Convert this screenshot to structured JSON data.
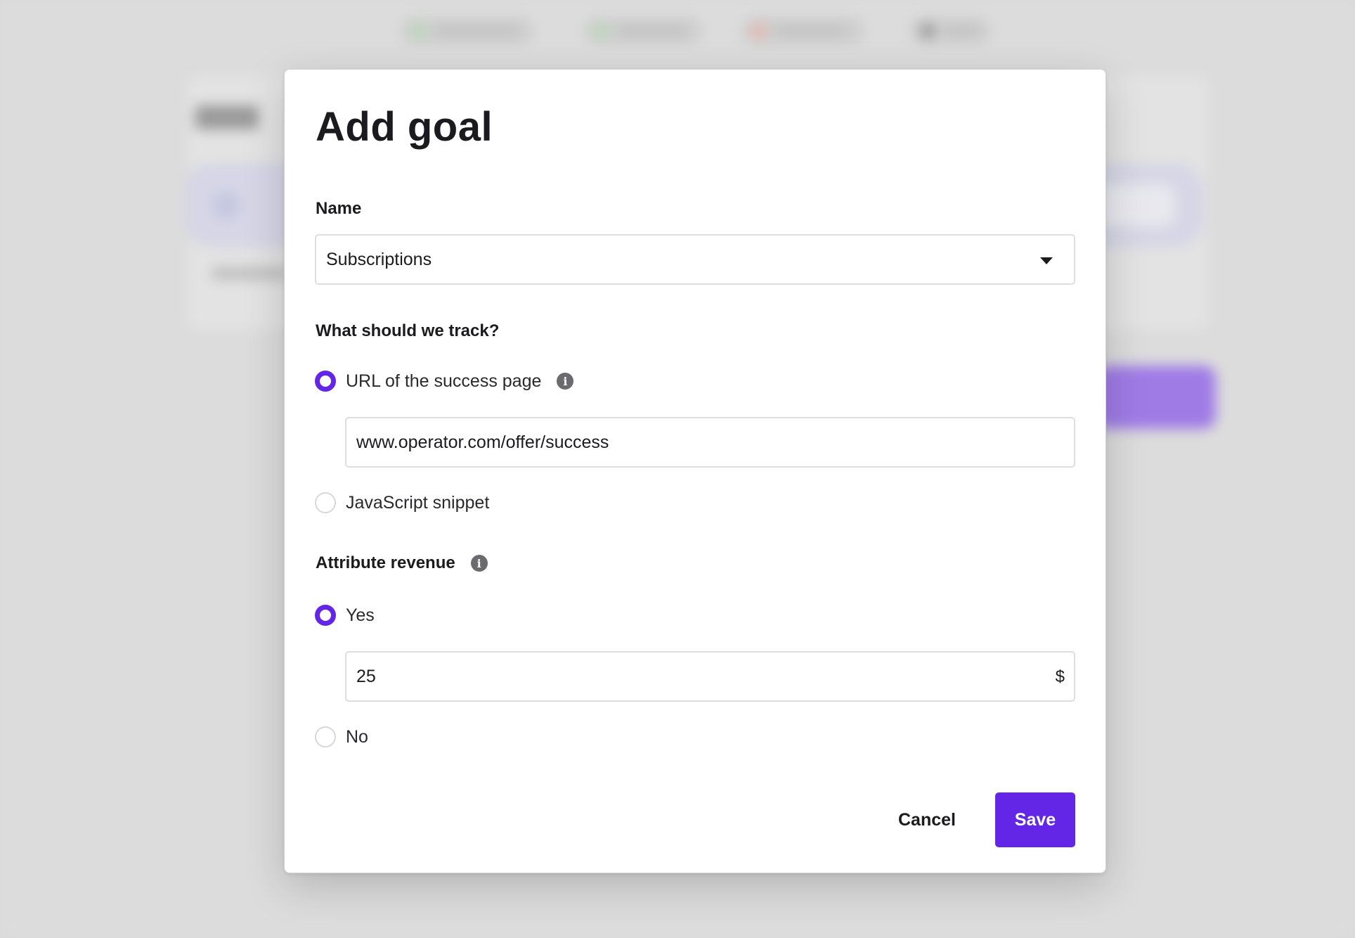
{
  "modal": {
    "title": "Add goal",
    "name_section": {
      "label": "Name",
      "selected_value": "Subscriptions"
    },
    "track_section": {
      "label": "What should we track?",
      "options": [
        {
          "label": "URL of the success page",
          "selected": true
        },
        {
          "label": "JavaScript snippet",
          "selected": false
        }
      ],
      "url_input_value": "www.operator.com/offer/success"
    },
    "revenue_section": {
      "label": "Attribute revenue",
      "options": [
        {
          "label": "Yes",
          "selected": true
        },
        {
          "label": "No",
          "selected": false
        }
      ],
      "amount_value": "25",
      "currency_suffix": "$"
    },
    "footer": {
      "cancel_label": "Cancel",
      "save_label": "Save"
    }
  },
  "colors": {
    "accent": "#6326e6",
    "backdrop": "#dadada",
    "text": "#1b1b1f"
  },
  "icons": {
    "info": "info-icon",
    "dropdown": "chevron-down-icon"
  }
}
